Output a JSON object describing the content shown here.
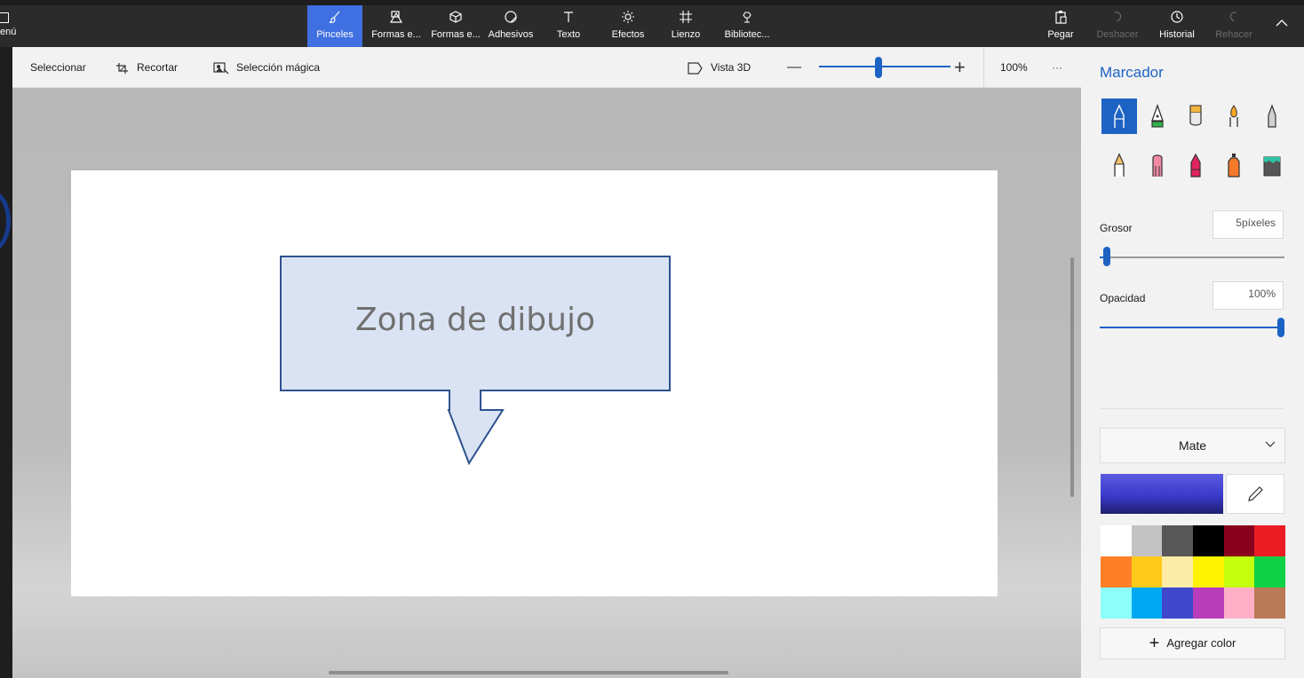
{
  "app": {
    "menu_label": "enú"
  },
  "ribbon": {
    "tabs": [
      {
        "label": "Pinceles",
        "icon": "brush-icon"
      },
      {
        "label": "Formas e...",
        "icon": "shapes-2d-icon"
      },
      {
        "label": "Formas e...",
        "icon": "shapes-3d-icon"
      },
      {
        "label": "Adhesivos",
        "icon": "stickers-icon"
      },
      {
        "label": "Texto",
        "icon": "text-icon"
      },
      {
        "label": "Efectos",
        "icon": "effects-icon"
      },
      {
        "label": "Lienzo",
        "icon": "canvas-icon"
      },
      {
        "label": "Bibliotec...",
        "icon": "library-icon"
      }
    ],
    "active_tab": "Pinceles",
    "actions": {
      "paste": "Pegar",
      "undo": "Deshacer",
      "history": "Historial",
      "redo": "Rehacer"
    }
  },
  "toolbar": {
    "select": "Seleccionar",
    "crop": "Recortar",
    "magic_select": "Selección mágica",
    "view_3d": "Vista 3D",
    "zoom_minus": "—",
    "zoom_plus": "+",
    "zoom": "100%",
    "more": "···",
    "zoom_level_fraction": 0.45
  },
  "canvas": {
    "callout_text": "Zona de dibujo",
    "callout_fill": "#dae3f3",
    "callout_stroke": "#2f528f"
  },
  "panel": {
    "title": "Marcador",
    "brushes": [
      "marker-icon",
      "calligraphy-pen-icon",
      "oil-brush-icon",
      "watercolor-icon",
      "pixel-pen-icon",
      "pencil-icon",
      "eraser-icon",
      "crayon-icon",
      "spray-can-icon",
      "fill-bucket-icon"
    ],
    "selected_brush": "marker-icon",
    "thickness": {
      "label": "Grosor",
      "value": "5píxeles",
      "level": 0.04
    },
    "opacity": {
      "label": "Opacidad",
      "value": "100%",
      "level": 1.0
    },
    "finish": "Mate",
    "current_color": "#3a3acd",
    "swatches": [
      "#ffffff",
      "#c3c3c3",
      "#585858",
      "#000000",
      "#88001b",
      "#ec1c24",
      "#ff7f27",
      "#ffca18",
      "#fdeca6",
      "#fff200",
      "#c4ff0e",
      "#0ed145",
      "#8cfffb",
      "#00a8f3",
      "#3f48cc",
      "#b83dba",
      "#ffaec8",
      "#b97a56"
    ],
    "add_color": "Agregar color"
  },
  "colors": {
    "accent": "#1d63c4",
    "ribbon_bg": "#2b2b2b",
    "active_tab": "#3f6fe0"
  }
}
